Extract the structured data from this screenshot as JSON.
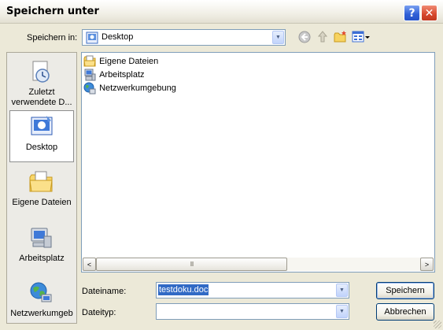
{
  "window": {
    "title": "Speichern unter",
    "help_label": "?",
    "close_label": "✕"
  },
  "toolbar": {
    "save_in_label": "Speichern in:",
    "location": "Desktop",
    "icons": [
      "back-icon",
      "up-folder-icon",
      "new-folder-icon",
      "view-menu-icon"
    ]
  },
  "places": [
    {
      "label": "Zuletzt verwendete D...",
      "icon": "recent-documents-icon",
      "active": false
    },
    {
      "label": "Desktop",
      "icon": "desktop-icon",
      "active": true
    },
    {
      "label": "Eigene Dateien",
      "icon": "my-documents-icon",
      "active": false
    },
    {
      "label": "Arbeitsplatz",
      "icon": "my-computer-icon",
      "active": false
    },
    {
      "label": "Netzwerkumgeb",
      "icon": "network-icon",
      "active": false
    }
  ],
  "files": [
    {
      "name": "Eigene Dateien",
      "icon": "folder-icon"
    },
    {
      "name": "Arbeitsplatz",
      "icon": "computer-icon"
    },
    {
      "name": "Netzwerkumgebung",
      "icon": "network-icon"
    }
  ],
  "scrollbar": {
    "left": "<",
    "right": ">",
    "thumb_grip": "III"
  },
  "form": {
    "filename_label": "Dateiname:",
    "filename_value": "testdoku.doc",
    "filetype_label": "Dateityp:",
    "filetype_value": ""
  },
  "buttons": {
    "save": "Speichern",
    "cancel": "Abbrechen"
  },
  "colors": {
    "accent": "#316ac5",
    "title_bg": "#ece9d8"
  }
}
